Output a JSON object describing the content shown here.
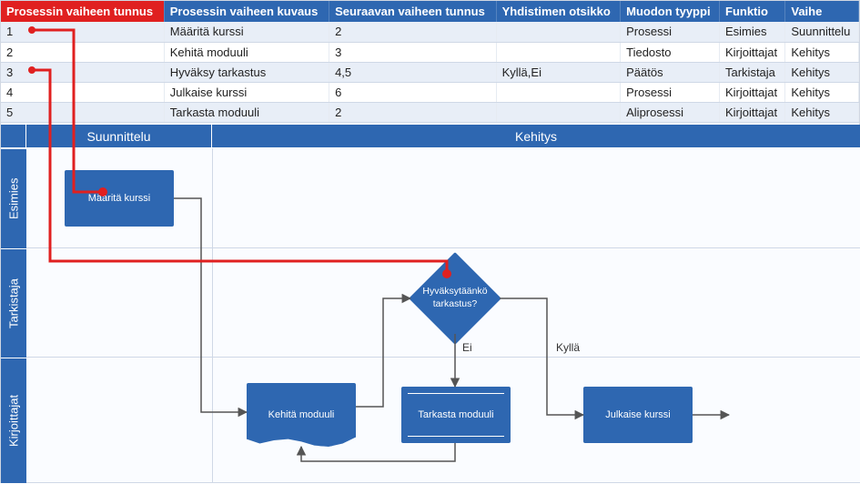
{
  "table": {
    "headers": {
      "col1": "Prosessin vaiheen tunnus",
      "col2": "Prosessin vaiheen kuvaus",
      "col3": "Seuraavan vaiheen tunnus",
      "col4": "Yhdistimen otsikko",
      "col5": "Muodon tyyppi",
      "col6": "Funktio",
      "col7": "Vaihe"
    },
    "rows": [
      {
        "id": "1",
        "desc": "Määritä kurssi",
        "next": "2",
        "conn": "",
        "type": "Prosessi",
        "func": "Esimies",
        "phase": "Suunnittelu"
      },
      {
        "id": "2",
        "desc": "Kehitä moduuli",
        "next": "3",
        "conn": "",
        "type": "Tiedosto",
        "func": "Kirjoittajat",
        "phase": "Kehitys"
      },
      {
        "id": "3",
        "desc": "Hyväksy tarkastus",
        "next": "4,5",
        "conn": "Kyllä,Ei",
        "type": "Päätös",
        "func": "Tarkistaja",
        "phase": "Kehitys"
      },
      {
        "id": "4",
        "desc": "Julkaise kurssi",
        "next": "6",
        "conn": "",
        "type": "Prosessi",
        "func": "Kirjoittajat",
        "phase": "Kehitys"
      },
      {
        "id": "5",
        "desc": "Tarkasta moduuli",
        "next": "2",
        "conn": "",
        "type": "Aliprosessi",
        "func": "Kirjoittajat",
        "phase": "Kehitys"
      }
    ]
  },
  "diagram": {
    "phases": {
      "p1": "Suunnittelu",
      "p2": "Kehitys"
    },
    "lanes": {
      "l1": "Esimies",
      "l2": "Tarkistaja",
      "l3": "Kirjoittajat"
    },
    "shapes": {
      "s1": "Määritä kurssi",
      "s2": "Kehitä moduuli",
      "s3": "Hyväksytäänkö tarkastus?",
      "s4": "Julkaise kurssi",
      "s5": "Tarkasta moduuli"
    },
    "labels": {
      "yes": "Kyllä",
      "no": "Ei"
    }
  },
  "colors": {
    "header_blue": "#2e67b1",
    "header_red": "#e02020",
    "callout_red": "#e02020"
  }
}
